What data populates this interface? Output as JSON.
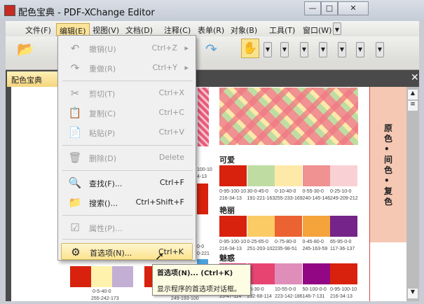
{
  "window": {
    "title": "配色宝典 - PDF-XChange Editor",
    "min": "—",
    "max": "□",
    "close": "✕"
  },
  "menubar": [
    "文件(F)",
    "编辑(E)",
    "视图(V)",
    "文档(D)",
    "注释(C)",
    "表单(R)",
    "对象(B)",
    "工具(T)",
    "窗口(W)"
  ],
  "tab": {
    "label": "配色宝典",
    "close": "✕"
  },
  "edit_menu": [
    {
      "label": "撤销(U)",
      "shortcut": "Ctrl+Z",
      "icon": "undo-icon",
      "glyph": "↶",
      "disabled": true,
      "sub": "▸"
    },
    {
      "label": "重做(R)",
      "shortcut": "Ctrl+Y",
      "icon": "redo-icon",
      "glyph": "↷",
      "disabled": true,
      "sub": "▸"
    },
    {
      "label": "剪切(T)",
      "shortcut": "Ctrl+X",
      "icon": "scissors-icon",
      "glyph": "✂",
      "disabled": true
    },
    {
      "label": "复制(C)",
      "shortcut": "Ctrl+C",
      "icon": "copy-icon",
      "glyph": "📋",
      "disabled": true
    },
    {
      "label": "粘贴(P)",
      "shortcut": "Ctrl+V",
      "icon": "paste-icon",
      "glyph": "📄",
      "disabled": true
    },
    {
      "label": "删除(D)",
      "shortcut": "Delete",
      "icon": "delete-icon",
      "glyph": "🗑",
      "disabled": true
    },
    {
      "label": "查找(F)...",
      "shortcut": "Ctrl+F",
      "icon": "find-icon",
      "glyph": "🔍",
      "disabled": false
    },
    {
      "label": "搜索()...",
      "shortcut": "Ctrl+Shift+F",
      "icon": "search-folder-icon",
      "glyph": "📁",
      "disabled": false
    },
    {
      "label": "属性(P)...",
      "shortcut": "",
      "icon": "properties-icon",
      "glyph": "☑",
      "disabled": true
    },
    {
      "label": "首选项(N)...",
      "shortcut": "Ctrl+K",
      "icon": "preferences-icon",
      "glyph": "⚙",
      "disabled": false,
      "highlighted": true
    }
  ],
  "tooltip": {
    "title": "首选项(N)... (Ctrl+K)",
    "desc": "显示程序的首选项对话框。"
  },
  "page": {
    "side_title": "原色•间色•复色",
    "sections": [
      {
        "title": "可爱",
        "swatches": [
          {
            "color": "#d8220d",
            "cmyk": "0-95-100-10",
            "rgb": "216-34-13"
          },
          {
            "color": "#bfdda3",
            "cmyk": "30-0-45-0",
            "rgb": "191-221-163"
          },
          {
            "color": "#ffe9a9",
            "cmyk": "0-10-40-0",
            "rgb": "255-233-169"
          },
          {
            "color": "#f09192",
            "cmyk": "0-55-30-0",
            "rgb": "240-145-146"
          },
          {
            "color": "#f9d1d4",
            "cmyk": "0-25-10-0",
            "rgb": "249-209-212"
          }
        ]
      },
      {
        "title": "艳丽",
        "swatches": [
          {
            "color": "#d8220d",
            "cmyk": "0-95-100-10",
            "rgb": "216-34-13"
          },
          {
            "color": "#fbcb66",
            "cmyk": "0-25-65-0",
            "rgb": "251-203-102"
          },
          {
            "color": "#eb6233",
            "cmyk": "0-75-80-0",
            "rgb": "235-98-51"
          },
          {
            "color": "#f5a33b",
            "cmyk": "0-45-80-0",
            "rgb": "245-163-59"
          },
          {
            "color": "#752489",
            "cmyk": "65-95-0-0",
            "rgb": "117-36-137"
          }
        ]
      },
      {
        "title": "魅惑",
        "swatches": [
          {
            "color": "#e0306a",
            "cmyk": "",
            "rgb": "25-47-114"
          },
          {
            "color": "#e84472",
            "cmyk": "85-30-0",
            "rgb": "232-68-114"
          },
          {
            "color": "#df8eba",
            "cmyk": "10-55-0-0",
            "rgb": "223-142-186"
          },
          {
            "color": "#920783",
            "cmyk": "50-100-0-0",
            "rgb": "146-7-131"
          },
          {
            "color": "#d8220d",
            "cmyk": "0-95-100-10",
            "rgb": "216-34-13"
          }
        ]
      }
    ],
    "left_labels": {
      "a1": "100-10",
      "a2": "4-13",
      "b1": "0-0",
      "b2": "0-221",
      "c1": "0-5-40-0",
      "c2": "255-242-173",
      "d2": "249-193-100"
    }
  },
  "colors": {
    "accent": "#fbe38e",
    "pink_strip": "#f5c8b4"
  }
}
